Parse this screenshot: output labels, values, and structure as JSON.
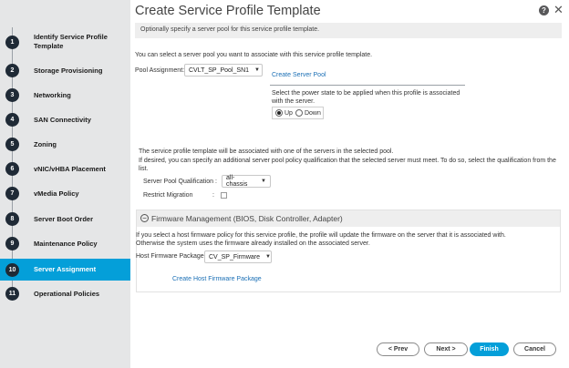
{
  "sidebar": {
    "steps": [
      {
        "num": "1",
        "label": "Identify Service Profile Template"
      },
      {
        "num": "2",
        "label": "Storage Provisioning"
      },
      {
        "num": "3",
        "label": "Networking"
      },
      {
        "num": "4",
        "label": "SAN Connectivity"
      },
      {
        "num": "5",
        "label": "Zoning"
      },
      {
        "num": "6",
        "label": "vNIC/vHBA Placement"
      },
      {
        "num": "7",
        "label": "vMedia Policy"
      },
      {
        "num": "8",
        "label": "Server Boot Order"
      },
      {
        "num": "9",
        "label": "Maintenance Policy"
      },
      {
        "num": "10",
        "label": "Server Assignment"
      },
      {
        "num": "11",
        "label": "Operational Policies"
      }
    ],
    "active_step": "10"
  },
  "header": {
    "title": "Create Service Profile Template",
    "help": "?",
    "close": "✕",
    "subtitle": "Optionally specify a server pool for this service profile template."
  },
  "pool": {
    "intro": "You can select a server pool you want to associate with this service profile template.",
    "label": "Pool Assignment:",
    "value": "CVLT_SP_Pool_SN1",
    "create_link": "Create Server Pool",
    "power_text": "Select the power state to be applied when this profile is associated with the server.",
    "power_up": "Up",
    "power_down": "Down",
    "power_selected": "Up"
  },
  "qualification": {
    "text1": "The service profile template will be associated with one of the servers in the selected pool.",
    "text2": "If desired, you can specify an additional server pool policy qualification that the selected server must meet. To do so, select the qualification from the list.",
    "label": "Server Pool Qualification :",
    "value": "all-chassis",
    "restrict_label": "Restrict Migration",
    "restrict_colon": ":",
    "restrict_checked": false
  },
  "firmware": {
    "header": "Firmware Management (BIOS, Disk Controller, Adapter)",
    "text1": "If you select a host firmware policy for this service profile, the profile will update the firmware on the server that it is associated with.",
    "text2": "Otherwise the system uses the firmware already installed on the associated server.",
    "label": "Host Firmware Package:",
    "value": "CV_SP_Firmware",
    "create_link": "Create Host Firmware Package"
  },
  "footer": {
    "prev": "< Prev",
    "next": "Next >",
    "finish": "Finish",
    "cancel": "Cancel"
  },
  "colors": {
    "accent": "#049fd9",
    "sidebar_bg": "#e5e6e7",
    "step_circle": "#1f2a36",
    "link": "#1a6fb5"
  }
}
